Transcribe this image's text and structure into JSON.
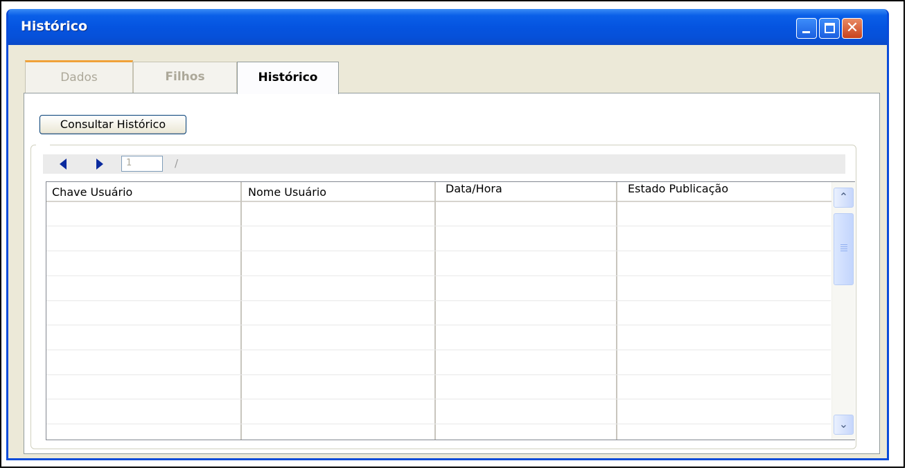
{
  "window": {
    "title": "Histórico",
    "controls": {
      "minimize": "minimize-icon",
      "maximize": "maximize-icon",
      "close": "close-icon"
    }
  },
  "tabs": [
    {
      "label": "Dados",
      "state": "disabled"
    },
    {
      "label": "Filhos",
      "state": "disabled"
    },
    {
      "label": "Histórico",
      "state": "active"
    }
  ],
  "actions": {
    "consult_label": "Consultar Histórico"
  },
  "pager": {
    "page_value": "1",
    "separator": "/",
    "total": ""
  },
  "table": {
    "columns": [
      "Chave Usuário",
      "Nome Usuário",
      "Data/Hora",
      "Estado Publicação"
    ],
    "rows": []
  },
  "colors": {
    "titlebar": "#0554e0",
    "window_bg": "#ece9d8",
    "active_tab_accent": "#f0a23a",
    "nav_arrow": "#0a2a9e"
  }
}
